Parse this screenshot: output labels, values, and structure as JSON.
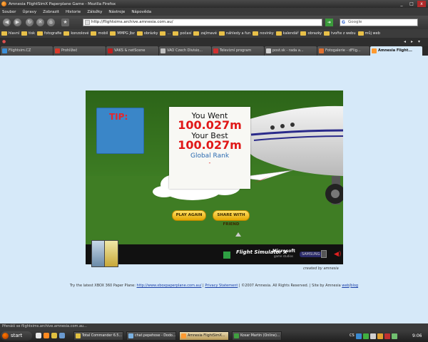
{
  "window": {
    "title": "Amnesia FlightSimX Paperplane Game - Mozilla Firefox",
    "controls": [
      "_",
      "□",
      "x"
    ]
  },
  "menu": [
    "Soubor",
    "Úpravy",
    "Zobrazit",
    "Historie",
    "Záložky",
    "Nástroje",
    "Nápověda"
  ],
  "nav": {
    "url": "http://flightsims.archive.amnesia.com.au/",
    "search_placeholder": "Google"
  },
  "bookmarks": [
    "hlavní",
    "tisk",
    "fotografie",
    "konzolové",
    "mobil",
    "MMPG Jbz",
    "obrázky",
    "…",
    "počasí",
    "zajímavé",
    "náhledy a fun",
    "novinky",
    "kalendář",
    "obrazky",
    "tvořte z webu",
    "můj web"
  ],
  "tabs": [
    {
      "label": "Flightsim.CZ",
      "color": "#3c8fd8"
    },
    {
      "label": "Prohlížeč",
      "color": "#d93a2a"
    },
    {
      "label": "VAKS & netScene",
      "color": "#c02020"
    },
    {
      "label": "VAO Czech Divisio...",
      "color": "#c0c0c0"
    },
    {
      "label": "Televizní program",
      "color": "#d03030"
    },
    {
      "label": "post.sk - rada a...",
      "color": "#d0d0d0"
    },
    {
      "label": "Fotogalerie - dFlig...",
      "color": "#e07030"
    },
    {
      "label": "Amnesia Flight...",
      "color": "#ff9a30",
      "active": true
    }
  ],
  "game": {
    "tip_label": "TIP:",
    "distance_caption": "You Went",
    "distance_value": "100.027m",
    "best_caption": "Your Best",
    "best_value": "100.027m",
    "rank_label": "Global Rank",
    "rank_value": "-",
    "play_again": "PLAY AGAIN",
    "share": "SHARE WITH FRIEND",
    "sponsor_fsx": "Flight Simulator X",
    "sponsor_ms": "Microsoft",
    "sponsor_ms_sub": "game studios",
    "sponsor_samsung": "SAMSUNG",
    "created_by": "created by amnesia"
  },
  "footer": {
    "prefix": "Try the latest XBOX 360 Paper Plane: ",
    "link": "http://www.xboxpaperplane.com.au/",
    "sep1": " | ",
    "privacy": "Privacy Statement",
    "mid": " | ©2007 Amnesia. All Rights Reserved. | Site by Amnesia ",
    "web": "web",
    "slash": "/",
    "blog": "blog"
  },
  "status": "Přenáší se flightsims.archive.amnesia.com.au...",
  "taskbar": {
    "start": "start",
    "tasks": [
      {
        "label": "Total Commander 6.5...",
        "color": "#e0c040"
      },
      {
        "label": "chat.pepehose - Dodo...",
        "color": "#7ab0e0"
      },
      {
        "label": "Amnesia FlightSimX...",
        "color": "#ff9a30",
        "active": true
      },
      {
        "label": "Kosar Martin (Online)...",
        "color": "#40a040"
      }
    ],
    "lang": "CS",
    "clock": "9:06"
  }
}
